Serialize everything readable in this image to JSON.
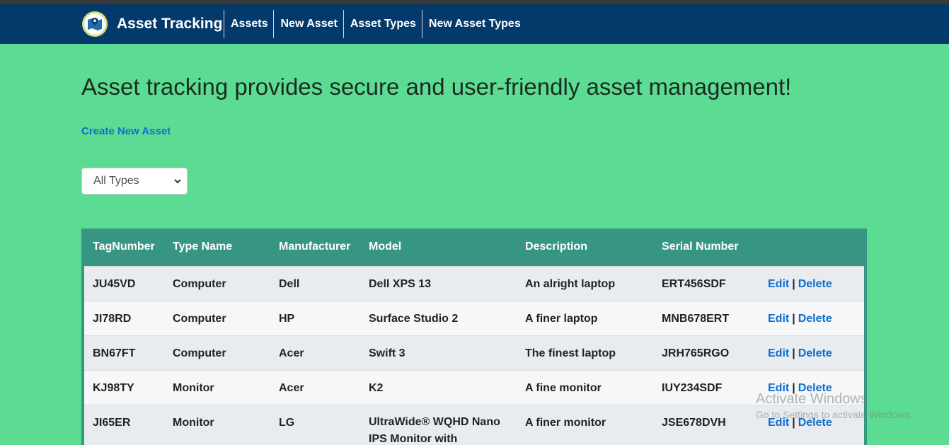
{
  "navbar": {
    "brand": "Asset Tracking",
    "links": [
      "Assets",
      "New Asset",
      "Asset Types",
      "New Asset Types"
    ]
  },
  "main": {
    "heading": "Asset tracking provides secure and user-friendly asset management!",
    "create_link": "Create New Asset",
    "type_filter": {
      "selected": "All Types"
    }
  },
  "table": {
    "headers": [
      "TagNumber",
      "Type Name",
      "Manufacturer",
      "Model",
      "Description",
      "Serial Number",
      ""
    ],
    "rows": [
      [
        "JU45VD",
        "Computer",
        "Dell",
        "Dell XPS 13",
        "An alright laptop",
        "ERT456SDF"
      ],
      [
        "JI78RD",
        "Computer",
        "HP",
        "Surface Studio 2",
        "A finer laptop",
        "MNB678ERT"
      ],
      [
        "BN67FT",
        "Computer",
        "Acer",
        "Swift 3",
        "The finest laptop",
        "JRH765RGO"
      ],
      [
        "KJ98TY",
        "Monitor",
        "Acer",
        "K2",
        "A fine monitor",
        "IUY234SDF"
      ],
      [
        "JI65ER",
        "Monitor",
        "LG",
        "UltraWide® WQHD Nano IPS Monitor with",
        "A finer monitor",
        "JSE678DVH"
      ]
    ],
    "actions": {
      "edit": "Edit",
      "separator": "|",
      "delete": "Delete"
    }
  },
  "watermark": {
    "line1": "Activate Windows",
    "line2": "Go to Settings to activate Windows."
  },
  "colors": {
    "navbar": "#043a6b",
    "page_background": "#5cdc93",
    "table_header": "#379584",
    "link": "#0d6ecd"
  }
}
